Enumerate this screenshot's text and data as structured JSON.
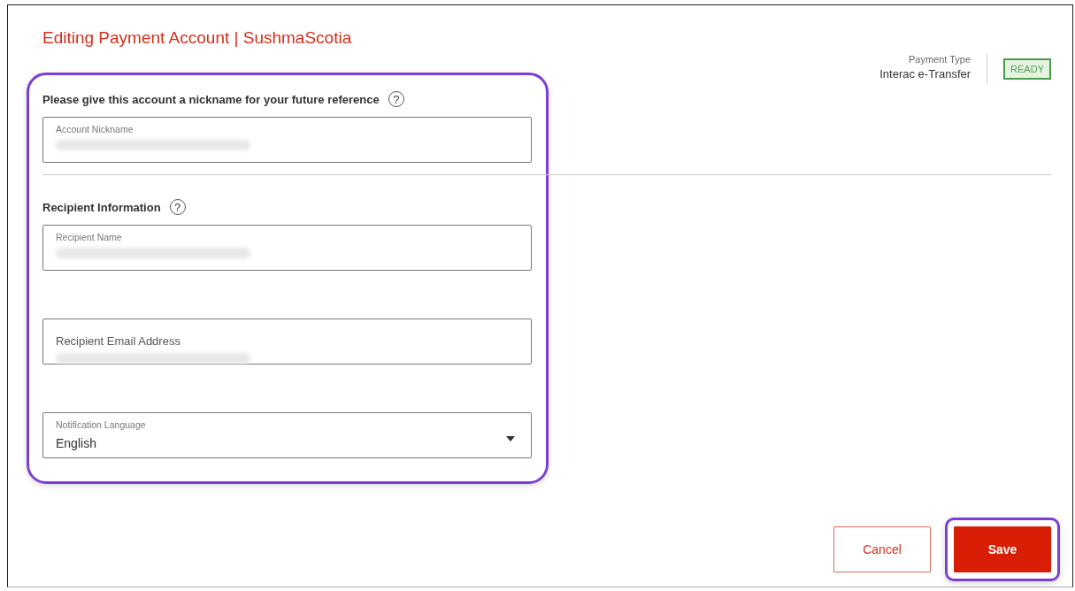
{
  "title": "Editing Payment Account | SushmaScotia",
  "payment_type": {
    "label": "Payment Type",
    "value": "Interac e-Transfer",
    "status": "READY"
  },
  "form": {
    "highlighted": true,
    "sections": [
      {
        "heading": "Please give this account a nickname for your future reference",
        "help": "?",
        "fields": [
          {
            "kind": "text",
            "label": "Account Nickname",
            "label_floating": true,
            "redacted": true
          }
        ]
      },
      {
        "heading": "Recipient Information",
        "help": "?",
        "fields": [
          {
            "kind": "text",
            "label": "Recipient Name",
            "label_floating": true,
            "redacted": true
          },
          {
            "kind": "text",
            "label": "Recipient Email Address",
            "label_floating": false,
            "redacted": true
          },
          {
            "kind": "select",
            "label": "Notification Language",
            "label_floating": true,
            "value": "English",
            "redacted": false
          }
        ]
      }
    ]
  },
  "actions": [
    {
      "kind": "secondary",
      "label": "Cancel",
      "highlighted": false
    },
    {
      "kind": "primary",
      "label": "Save",
      "highlighted": true
    }
  ]
}
